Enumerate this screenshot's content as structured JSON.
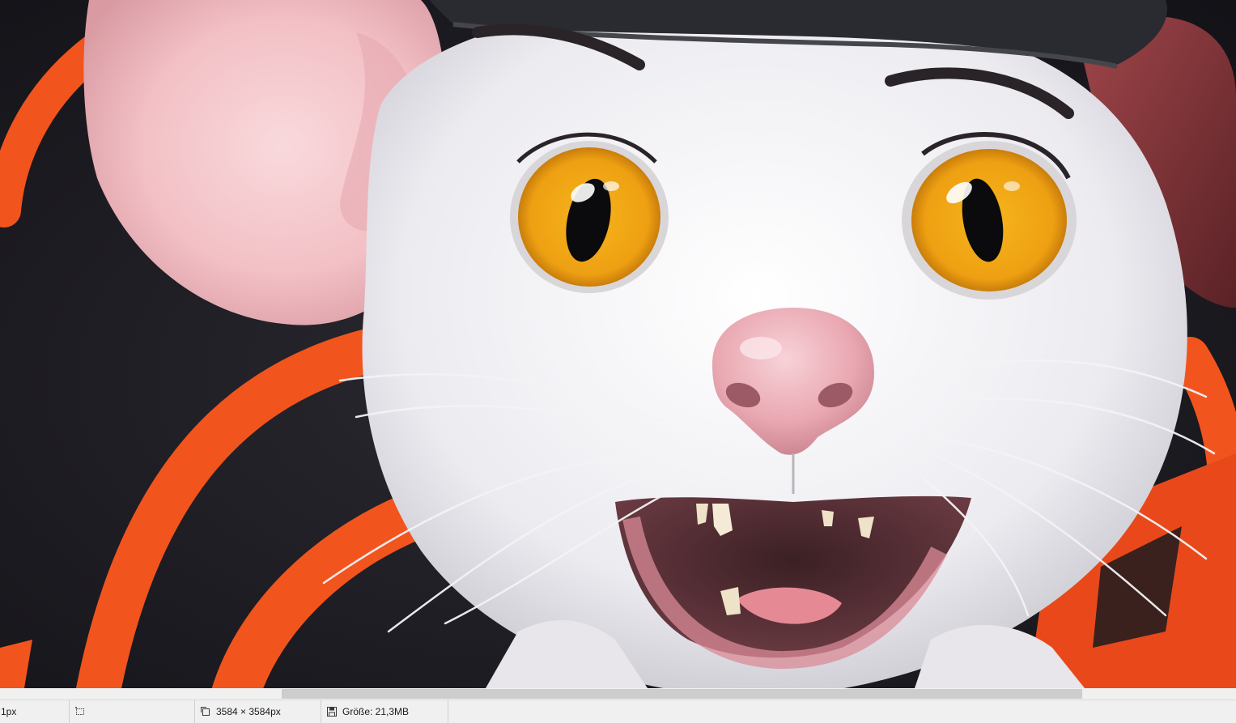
{
  "canvas": {
    "subject": "illustration-white-mouse-character"
  },
  "scrollbar": {
    "horizontal": {
      "position": 0.228,
      "visible_fraction": 0.648
    }
  },
  "statusbar": {
    "zoom_value": "1px",
    "selection_icon": "selection-icon",
    "dimensions_icon": "image-size-icon",
    "dimensions_text": "3584 × 3584px",
    "filesize_icon": "save-disk-icon",
    "filesize_text": "Größe: 21,3MB"
  },
  "colors": {
    "background_dark": "#1b1a1e",
    "accent_orange": "#f2541e",
    "eye_amber": "#f2a819",
    "fur_white": "#f1f0f4",
    "statusbar_bg": "#f0f0f0"
  }
}
